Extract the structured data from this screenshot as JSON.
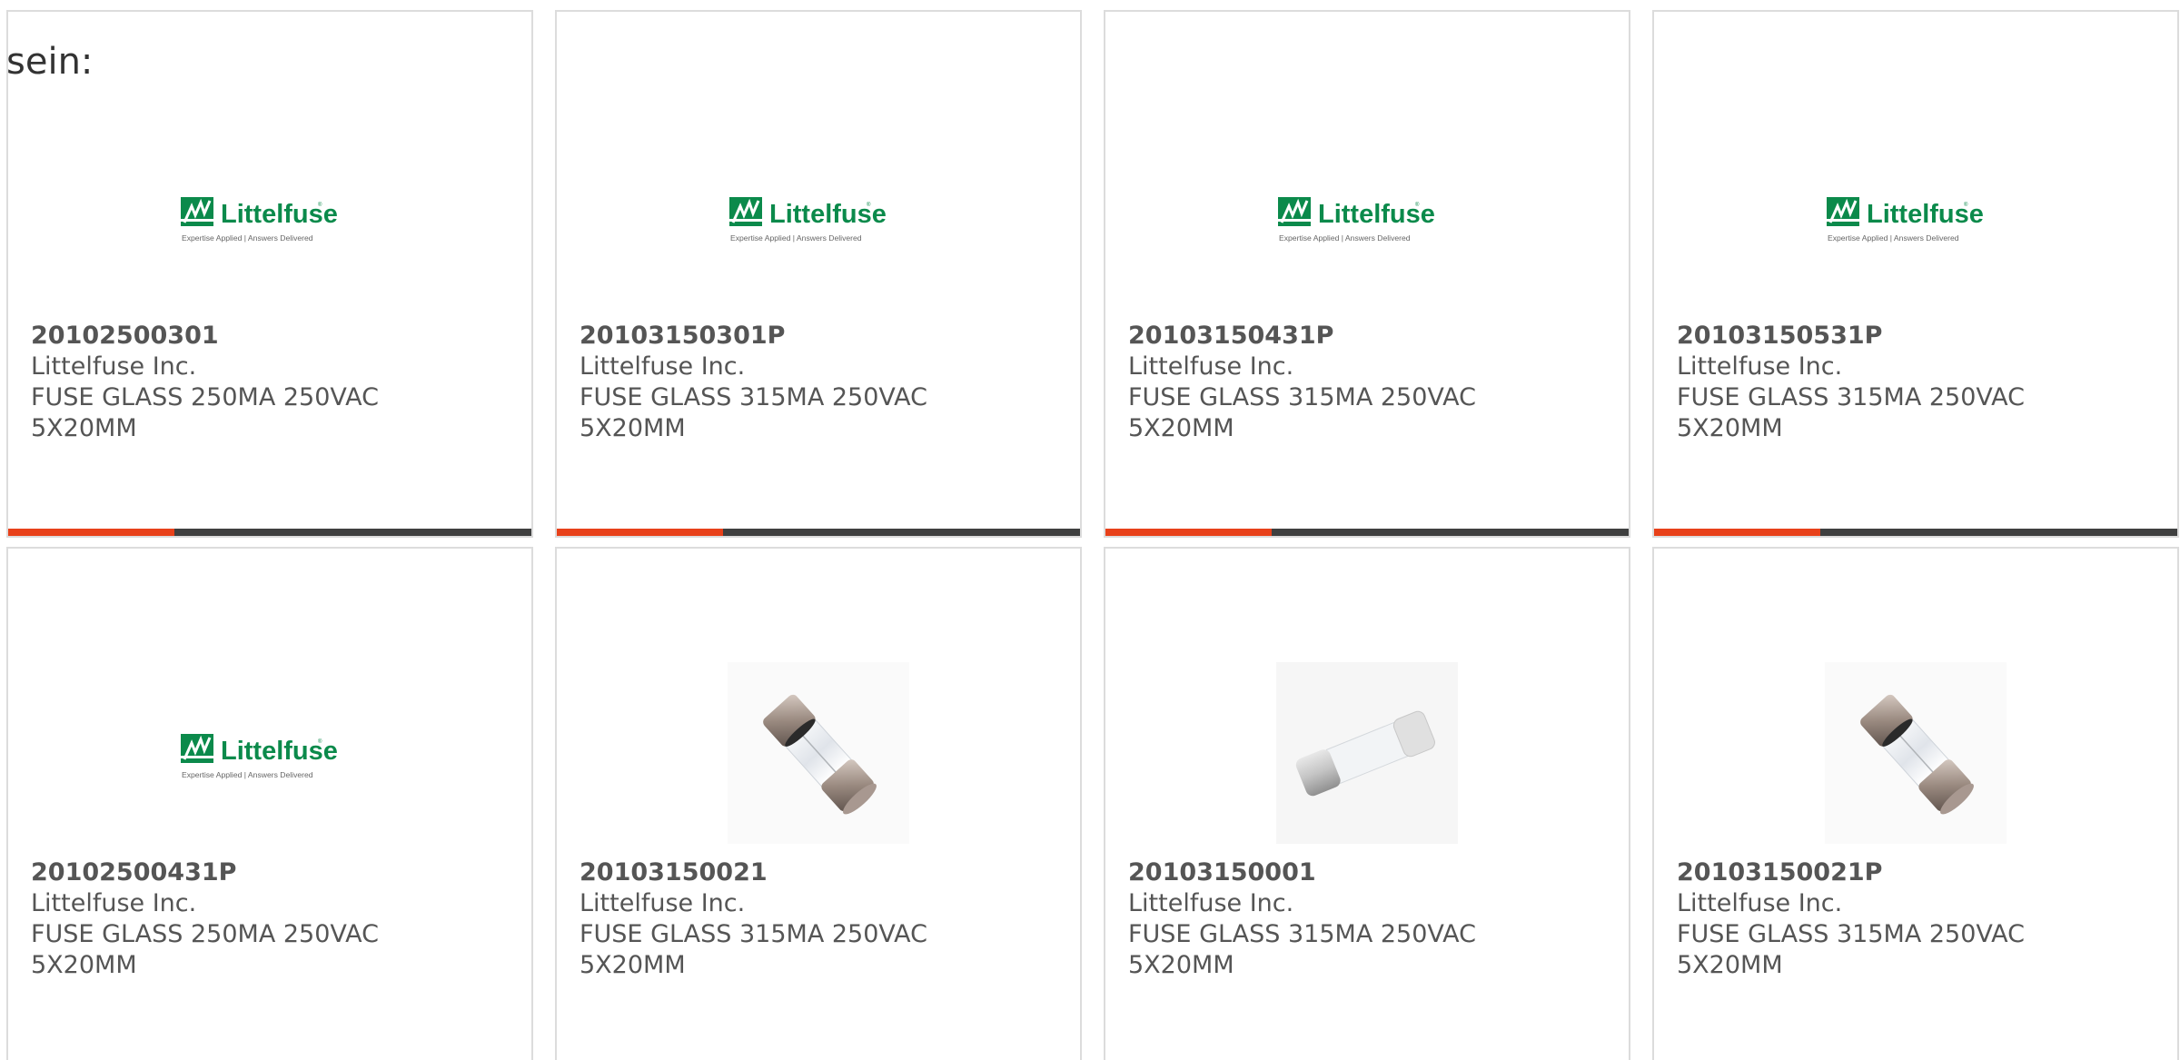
{
  "intro_text": "sein:",
  "colors": {
    "accent": "#e8411a",
    "bar_dark": "#3f4040",
    "logo_green": "#0b8a4b",
    "text": "#555555",
    "border": "#dcdcdc"
  },
  "logo": {
    "name": "Littelfuse",
    "tagline_left": "Expertise Applied",
    "tagline_right": "Answers Delivered",
    "icon": "littelfuse-logo-icon"
  },
  "products": [
    {
      "part_number": "20102500301",
      "manufacturer": "Littelfuse Inc.",
      "description": "FUSE GLASS 250MA 250VAC 5X20MM",
      "image": "littelfuse-logo"
    },
    {
      "part_number": "20103150301P",
      "manufacturer": "Littelfuse Inc.",
      "description": "FUSE GLASS 315MA 250VAC 5X20MM",
      "image": "littelfuse-logo"
    },
    {
      "part_number": "20103150431P",
      "manufacturer": "Littelfuse Inc.",
      "description": "FUSE GLASS 315MA 250VAC 5X20MM",
      "image": "littelfuse-logo"
    },
    {
      "part_number": "20103150531P",
      "manufacturer": "Littelfuse Inc.",
      "description": "FUSE GLASS 315MA 250VAC 5X20MM",
      "image": "littelfuse-logo"
    },
    {
      "part_number": "20102500431P",
      "manufacturer": "Littelfuse Inc.",
      "description": "FUSE GLASS 250MA 250VAC 5X20MM",
      "image": "littelfuse-logo"
    },
    {
      "part_number": "20103150021",
      "manufacturer": "Littelfuse Inc.",
      "description": "FUSE GLASS 315MA 250VAC 5X20MM",
      "image": "fuse-photo-diagonal"
    },
    {
      "part_number": "20103150001",
      "manufacturer": "Littelfuse Inc.",
      "description": "FUSE GLASS 315MA 250VAC 5X20MM",
      "image": "fuse-photo-horizontal"
    },
    {
      "part_number": "20103150021P",
      "manufacturer": "Littelfuse Inc.",
      "description": "FUSE GLASS 315MA 250VAC 5X20MM",
      "image": "fuse-photo-diagonal"
    }
  ]
}
